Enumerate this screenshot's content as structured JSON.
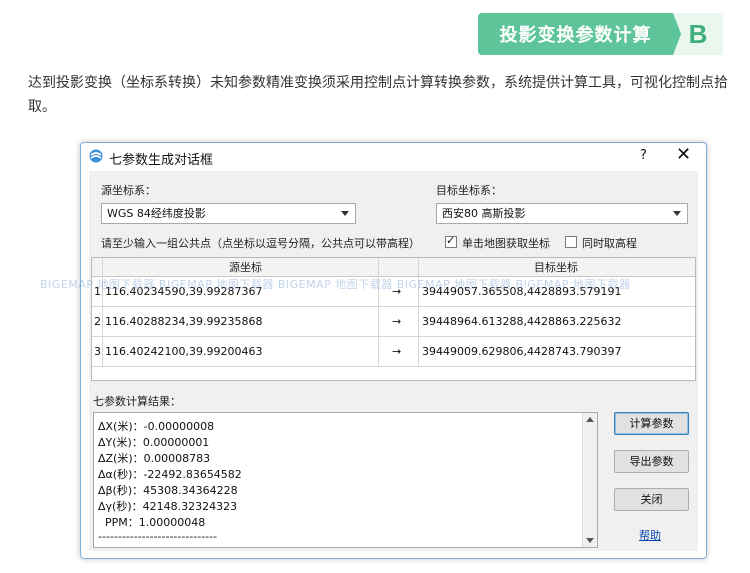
{
  "badge": {
    "title": "投影变换参数计算",
    "letter": "B"
  },
  "intro": "达到投影变换（坐标系转换）未知参数精准变换须采用控制点计算转换参数，系统提供计算工具，可视化控制点拾取。",
  "dialog": {
    "title": "七参数生成对话框",
    "help_symbol": "?",
    "close_symbol": "✕",
    "source_label": "源坐标系：",
    "source_value": "WGS 84经纬度投影",
    "target_label": "目标坐标系：",
    "target_value": "西安80 高斯投影",
    "hint": "请至少输入一组公共点（点坐标以逗号分隔，公共点可以带高程）",
    "chk_map_pick": "单击地图获取坐标",
    "chk_height": "同时取高程",
    "table": {
      "headers": [
        "源坐标",
        "目标坐标"
      ],
      "rows": [
        {
          "idx": "1",
          "src": "116.40234590,39.99287367",
          "arrow": "→",
          "dst": "39449057.365508,4428893.579191"
        },
        {
          "idx": "2",
          "src": "116.40288234,39.99235868",
          "arrow": "→",
          "dst": "39448964.613288,4428863.225632"
        },
        {
          "idx": "3",
          "src": "116.40242100,39.99200463",
          "arrow": "→",
          "dst": "39449009.629806,4428743.790397"
        }
      ]
    },
    "watermark": "BIGEMAP 地图下载器 BIGEMAP 地图下载器 BIGEMAP 地图下载器 BIGEMAP 地图下载器 BIGEMAP 地图下载器",
    "result_label": "七参数计算结果：",
    "results": [
      "ΔX(米)：-0.00000008",
      "ΔY(米)：0.00000001",
      "ΔZ(米)：0.00008783",
      "Δα(秒)：-22492.83654582",
      "Δβ(秒)：45308.34364228",
      "Δγ(秒)：42148.32324323",
      "  PPM：1.00000048",
      "------------------------------"
    ],
    "buttons": {
      "compute": "计算参数",
      "export": "导出参数",
      "close": "关闭",
      "help": "帮助"
    }
  }
}
